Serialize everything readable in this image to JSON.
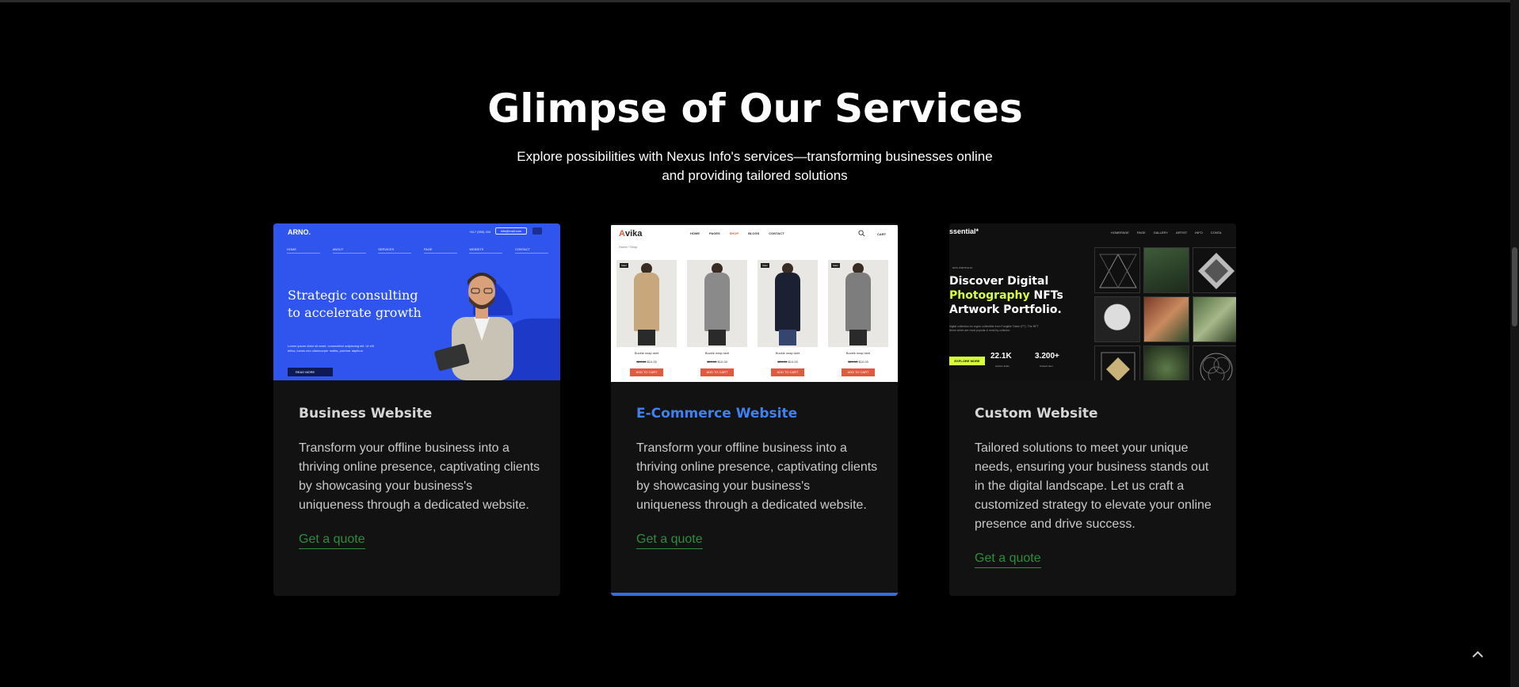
{
  "section": {
    "heading": "Glimpse of Our Services",
    "subtitle": "Explore possibilities with Nexus Info's services—transforming businesses online and providing tailored solutions"
  },
  "cards": [
    {
      "title": "Business Website",
      "description": "Transform your offline business into a thriving online presence, captivating clients by showcasing your business's uniqueness through a dedicated website.",
      "link": "Get a quote",
      "preview": {
        "logo": "ARNO.",
        "phone": "+617 (555) 434",
        "mail": "info@mail.com",
        "nav": [
          "HOME",
          "ABOUT",
          "SERVICES",
          "PAGE",
          "WEBSITE",
          "CONTACT"
        ],
        "hero": "Strategic consulting to accelerate growth",
        "small": "Lorem ipsum dolor sit amet, consectetur adipiscing elit. Ut elit tellus, luctus nec ullamcorper mattis, pulvinar dapibus.",
        "button": "READ MORE",
        "accent_color": "#2f55ee"
      }
    },
    {
      "title": "E-Commerce Website",
      "description": "Transform your offline business into a thriving online presence, captivating clients by showcasing your business's uniqueness through a dedicated website.",
      "link": "Get a quote",
      "preview": {
        "logo_a": "A",
        "logo_rest": "vika",
        "nav": [
          "HOME",
          "PAGES",
          "SHOP",
          "BLOGS",
          "CONTACT"
        ],
        "cart": "CART",
        "breadcrumb": "Home  /  Shop",
        "products": [
          {
            "tag": "Sale!",
            "name": "Buckle wrap skirt",
            "old": "$20.00",
            "price": "$10.00",
            "cart": "ADD TO CART"
          },
          {
            "tag": "",
            "name": "Buckle wrap skirt",
            "old": "$20.00",
            "price": "$10.00",
            "cart": "ADD TO CART"
          },
          {
            "tag": "Sale!",
            "name": "Buckle wrap skirt",
            "old": "$20.00",
            "price": "$10.00",
            "cart": "ADD TO CART"
          },
          {
            "tag": "Sale!",
            "name": "Buckle wrap skirt",
            "old": "$20.00",
            "price": "$10.00",
            "cart": "ADD TO CART"
          }
        ]
      }
    },
    {
      "title": "Custom Website",
      "description": "Tailored solutions to meet your unique needs, ensuring your business stands out in the digital landscape. Let us craft a customized strategy to elevate your online presence and drive success.",
      "link": "Get a quote",
      "preview": {
        "logo": "ssential*",
        "nav": [
          "HOMEPAGE",
          "PAGE",
          "GALLERY",
          "ARTIST",
          "INFO",
          "CONTA"
        ],
        "tag": "NFTs PORTFOLIO",
        "headline_1": "Discover Digital",
        "headline_hl": "Photography",
        "headline_2": " NFTs",
        "headline_3": "Artwork Portfolio.",
        "description": "digital collection for crypto collectible from Fungible Token (FT). The NFT Items which are most popular & most by collector.",
        "button": "EXPLORE MORE",
        "stats": [
          {
            "value": "22.1K",
            "label": "Auction Ends"
          },
          {
            "value": "3.200+",
            "label": "Artwork Item"
          }
        ],
        "highlight_color": "#d8ff3c"
      }
    }
  ],
  "active_card_accent": "#2f6fe0",
  "link_color": "#2f8d3e"
}
